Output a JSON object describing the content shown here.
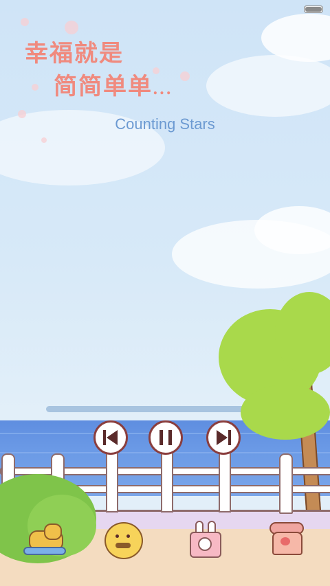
{
  "status_bar": {
    "battery_level": 1.0
  },
  "wallpaper_text": {
    "line1": "幸福就是",
    "line2": "简简单单",
    "trailing": "..."
  },
  "player": {
    "song_title": "Counting Stars",
    "progress": 0.0,
    "controls": {
      "previous": "previous-track",
      "play_pause": "pause",
      "next": "next-track"
    }
  },
  "colors": {
    "sky": "#cfe4f7",
    "title_text": "#6c9ad2",
    "progress_track": "#a8c4e0",
    "control_outline": "#8a3e3e",
    "sea": "#6b9ae6",
    "slogan": "#f08a7e"
  },
  "decorations": [
    "horse-icon",
    "mustache-face-icon",
    "bunny-camera-icon",
    "telephone-icon"
  ]
}
